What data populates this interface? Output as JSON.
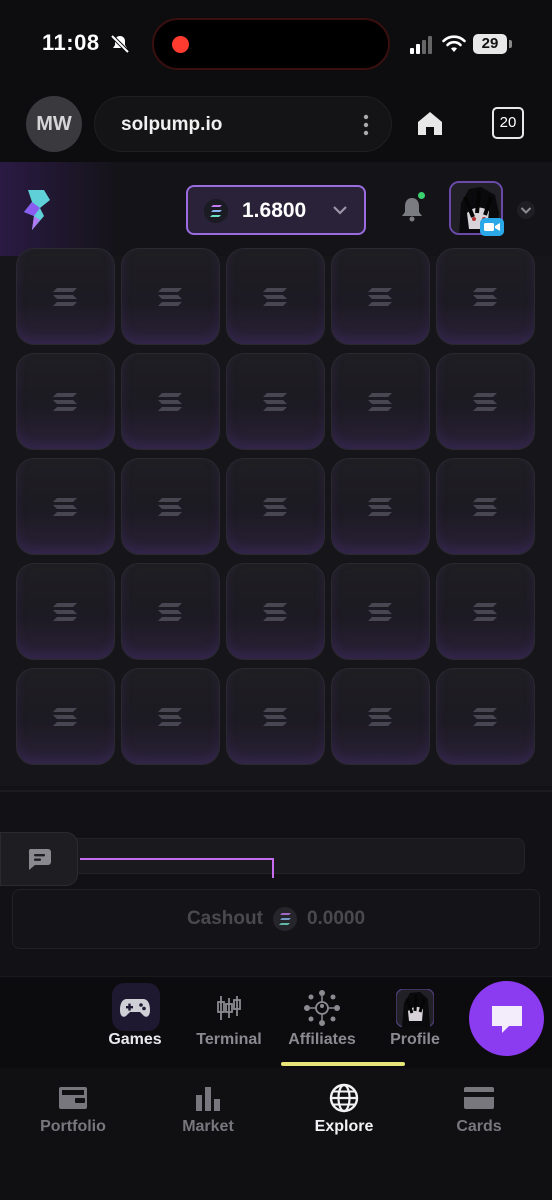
{
  "status_bar": {
    "time": "11:08",
    "battery": "29"
  },
  "browser": {
    "avatar_initials": "MW",
    "url": "solpump.io",
    "tab_count": "20"
  },
  "header": {
    "balance": "1.6800"
  },
  "grid": {
    "rows": 5,
    "columns": 5
  },
  "cashout": {
    "label": "Cashout",
    "amount": "0.0000"
  },
  "app_nav": {
    "items": [
      {
        "label": "Games",
        "icon": "gamepad-icon"
      },
      {
        "label": "Terminal",
        "icon": "candlestick-icon"
      },
      {
        "label": "Affiliates",
        "icon": "network-icon"
      },
      {
        "label": "Profile",
        "icon": "avatar-icon"
      }
    ],
    "active": "Affiliates"
  },
  "bottom_nav": {
    "items": [
      {
        "label": "Portfolio",
        "icon": "portfolio-icon"
      },
      {
        "label": "Market",
        "icon": "bar-chart-icon"
      },
      {
        "label": "Explore",
        "icon": "globe-icon"
      },
      {
        "label": "Cards",
        "icon": "card-icon"
      }
    ],
    "active": "Explore"
  },
  "colors": {
    "accent": "#9a6ce0",
    "fab": "#8b3bf0",
    "active_indicator": "#e8e67a",
    "background": "#161519"
  }
}
